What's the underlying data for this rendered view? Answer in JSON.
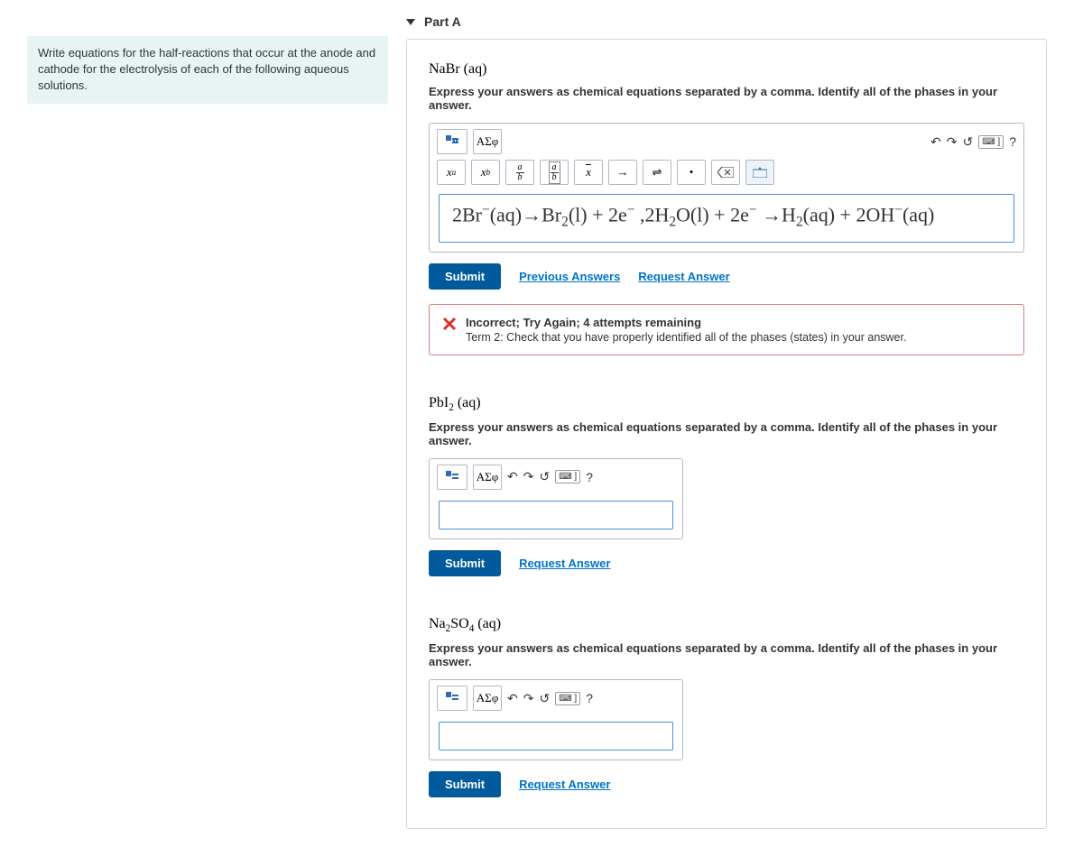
{
  "part_title": "Part A",
  "prompt": "Write equations for the half-reactions that occur at the anode and cathode for the electrolysis of each of the following aqueous solutions.",
  "instructions": "Express your answers as chemical equations separated by a comma. Identify all of the phases in your answer.",
  "submit_label": "Submit",
  "previous_answers_label": "Previous Answers",
  "request_answer_label": "Request Answer",
  "greek_label": "ΑΣφ",
  "help_symbol": "?",
  "subparts": [
    {
      "compound_html": "NaBr (aq)"
    },
    {
      "compound_html": "PbI₂ (aq)"
    },
    {
      "compound_html": "Na₂SO₄ (aq)"
    }
  ],
  "answer_entered": "2Br⁻(aq)→Br₂(l) + 2e⁻ ,2H₂O(l) + 2e⁻ →H₂(aq) + 2OH⁻(aq)",
  "feedback": {
    "title": "Incorrect; Try Again; 4 attempts remaining",
    "body": "Term 2: Check that you have properly identified all of the phases (states) in your answer."
  },
  "format_tools": {
    "superscript": "xᵃ",
    "subscript": "x_b",
    "frac_a": "a",
    "frac_b": "b",
    "xbar": "x̄",
    "arrow": "→",
    "equilibrium": "⇌",
    "dot": "•",
    "backspace": "⌫"
  }
}
